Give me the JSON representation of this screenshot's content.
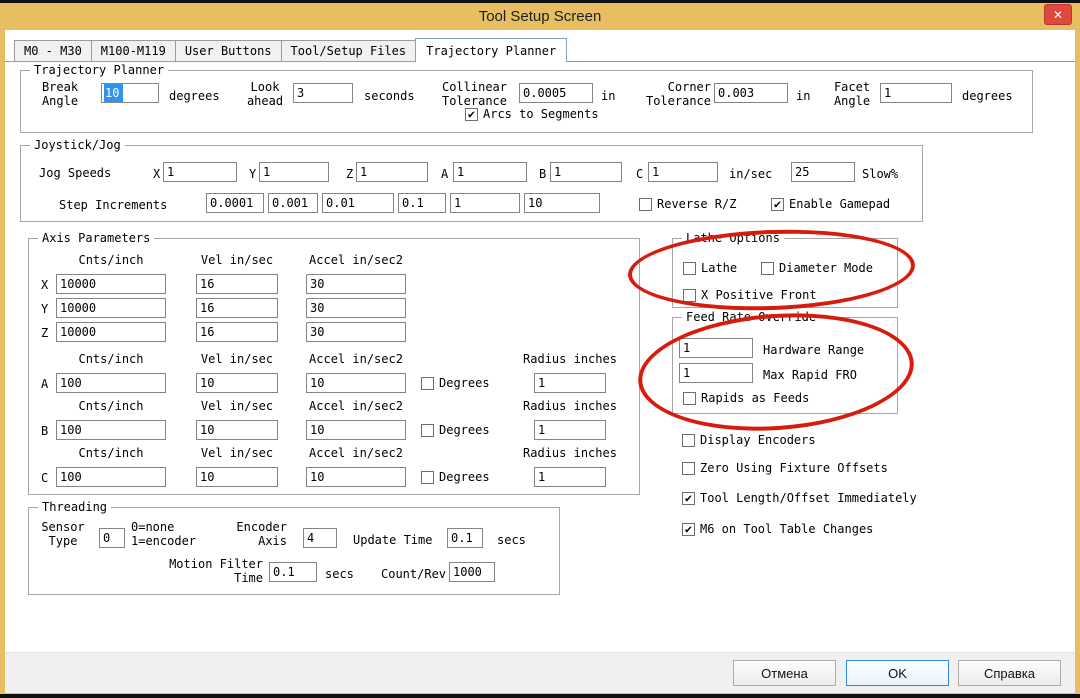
{
  "window": {
    "title": "Tool Setup Screen",
    "close": "✕"
  },
  "colors": {
    "titlebar": "#e7bf62",
    "annotation": "#d61c0c",
    "close_button": "#e0483e",
    "selection": "#3193f0"
  },
  "tabs": [
    {
      "label": "M0 - M30",
      "active": false
    },
    {
      "label": "M100-M119",
      "active": false
    },
    {
      "label": "User Buttons",
      "active": false
    },
    {
      "label": "Tool/Setup Files",
      "active": false
    },
    {
      "label": "Trajectory Planner",
      "active": true
    }
  ],
  "trajectory": {
    "title": "Trajectory Planner",
    "break_angle_label": "Break\nAngle",
    "break_angle_value": "10",
    "break_angle_unit": "degrees",
    "look_ahead_label": "Look\nahead",
    "look_ahead_value": "3",
    "look_ahead_unit": "seconds",
    "collinear_label": "Collinear\nTolerance",
    "collinear_value": "0.0005",
    "collinear_unit": "in",
    "arcs_label": "Arcs to Segments",
    "arcs_checked": true,
    "corner_label": "Corner\nTolerance",
    "corner_value": "0.003",
    "corner_unit": "in",
    "facet_label": "Facet\nAngle",
    "facet_value": "1",
    "facet_unit": "degrees"
  },
  "joystick": {
    "title": "Joystick/Jog",
    "jog_speeds_label": "Jog Speeds",
    "axes": [
      {
        "label": "X",
        "value": "1"
      },
      {
        "label": "Y",
        "value": "1"
      },
      {
        "label": "Z",
        "value": "1"
      },
      {
        "label": "A",
        "value": "1"
      },
      {
        "label": "B",
        "value": "1"
      },
      {
        "label": "C",
        "value": "1"
      }
    ],
    "unit": "in/sec",
    "slow_value": "25",
    "slow_label": "Slow%",
    "step_label": "Step Increments",
    "steps": [
      "0.0001",
      "0.001",
      "0.01",
      "0.1",
      "1",
      "10"
    ],
    "reverse_label": "Reverse R/Z",
    "reverse_checked": false,
    "gamepad_label": "Enable Gamepad",
    "gamepad_checked": true
  },
  "axis": {
    "title": "Axis Parameters",
    "h_cnts": "Cnts/inch",
    "h_vel": "Vel in/sec",
    "h_accel": "Accel in/sec2",
    "h_radius": "Radius inches",
    "degrees_label": "Degrees",
    "linear": [
      {
        "name": "X",
        "cnts": "10000",
        "vel": "16",
        "accel": "30"
      },
      {
        "name": "Y",
        "cnts": "10000",
        "vel": "16",
        "accel": "30"
      },
      {
        "name": "Z",
        "cnts": "10000",
        "vel": "16",
        "accel": "30"
      }
    ],
    "rotary": [
      {
        "name": "A",
        "cnts": "100",
        "vel": "10",
        "accel": "10",
        "degrees": false,
        "radius": "1"
      },
      {
        "name": "B",
        "cnts": "100",
        "vel": "10",
        "accel": "10",
        "degrees": false,
        "radius": "1"
      },
      {
        "name": "C",
        "cnts": "100",
        "vel": "10",
        "accel": "10",
        "degrees": false,
        "radius": "1"
      }
    ]
  },
  "lathe": {
    "title": "Lathe Options",
    "lathe_label": "Lathe",
    "lathe_checked": false,
    "diameter_label": "Diameter Mode",
    "diameter_checked": false,
    "xpos_label": "X Positive Front",
    "xpos_checked": false
  },
  "fro": {
    "title": "Feed Rate Override",
    "hw_value": "1",
    "hw_label": "Hardware Range",
    "rapid_value": "1",
    "rapid_label": "Max Rapid FRO",
    "rapids_feeds_label": "Rapids as Feeds",
    "rapids_feeds_checked": false
  },
  "misc": [
    {
      "label": "Display Encoders",
      "checked": false
    },
    {
      "label": "Zero Using Fixture Offsets",
      "checked": false
    },
    {
      "label": "Tool Length/Offset Immediately",
      "checked": true
    },
    {
      "label": "M6 on Tool Table Changes",
      "checked": true
    }
  ],
  "threading": {
    "title": "Threading",
    "sensor_label": "Sensor\nType",
    "sensor_value": "0",
    "sensor_hint": "0=none\n1=encoder",
    "encoder_label": "Encoder\nAxis",
    "encoder_value": "4",
    "update_label": "Update Time",
    "update_value": "0.1",
    "update_unit": "secs",
    "filter_label": "Motion Filter\nTime",
    "filter_value": "0.1",
    "filter_unit": "secs",
    "countrev_label": "Count/Rev",
    "countrev_value": "1000"
  },
  "footer": {
    "cancel": "Отмена",
    "ok": "OK",
    "help": "Справка"
  }
}
